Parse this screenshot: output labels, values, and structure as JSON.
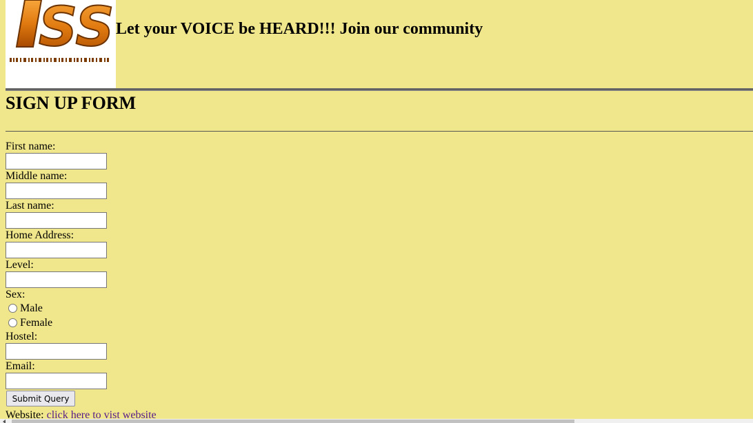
{
  "header": {
    "logo_text": "SS",
    "title": "Let your VOICE be HEARD!!! Join our community"
  },
  "form": {
    "title": "SIGN UP FORM",
    "fields": {
      "first_name": "First name:",
      "middle_name": "Middle name:",
      "last_name": "Last name:",
      "home_address": "Home Address:",
      "level": "Level:",
      "sex": "Sex:",
      "hostel": "Hostel:",
      "email": "Email:"
    },
    "sex_options": {
      "male": "Male",
      "female": "Female"
    },
    "submit_label": "Submit Query",
    "website_label": "Website:",
    "website_link": "click here to vist website"
  },
  "colors": {
    "page_background": "#f0e68c",
    "link": "#551a8b",
    "logo_orange": "#e07a10"
  },
  "icons": {
    "logo": "iss-logo"
  }
}
